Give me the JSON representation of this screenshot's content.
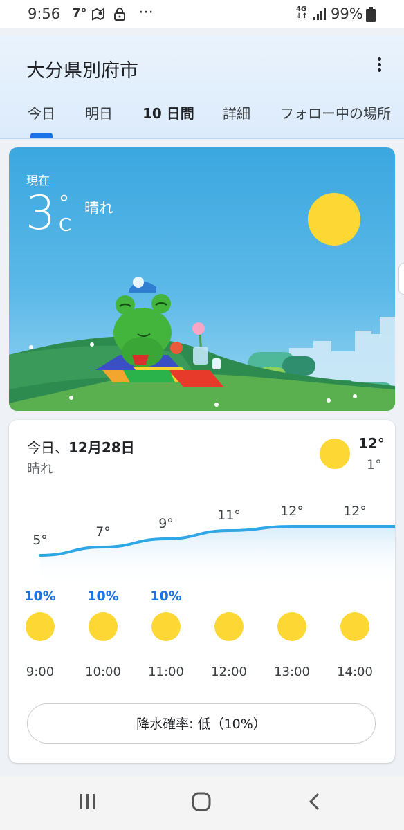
{
  "status_bar": {
    "time": "9:56",
    "temp": "7°",
    "network": "4G",
    "battery": "99%",
    "overflow": "⋯"
  },
  "header": {
    "city": "大分県別府市",
    "tabs": [
      {
        "label": "今日"
      },
      {
        "label": "明日"
      },
      {
        "label": "10 日間"
      },
      {
        "label": "詳細"
      },
      {
        "label": "フォロー中の場所"
      }
    ],
    "active_tab": 0
  },
  "current": {
    "label": "現在",
    "temp": "3",
    "deg": "°",
    "unit": "C",
    "condition": "晴れ"
  },
  "today": {
    "title_prefix": "今日、",
    "date": "12月28日",
    "condition": "晴れ",
    "high": "12°",
    "low": "1°",
    "rain_button": "降水確率: 低（10%）"
  },
  "chart_data": {
    "type": "line",
    "x": [
      "9:00",
      "10:00",
      "11:00",
      "12:00",
      "13:00",
      "14:00"
    ],
    "series": [
      {
        "values": [
          5,
          7,
          9,
          11,
          12,
          12
        ]
      }
    ],
    "point_labels": [
      "5°",
      "7°",
      "9°",
      "11°",
      "12°",
      "12°"
    ],
    "precipitation": [
      "10%",
      "10%",
      "10%",
      "",
      "",
      ""
    ],
    "ylim": [
      4,
      13
    ]
  },
  "colors": {
    "accent": "#1a73e8",
    "line": "#2fa6e6",
    "sun": "#fdd835",
    "sky": "#3ba7df"
  },
  "icons": {
    "more": "more-vert-icon",
    "nav_recent": "recent-apps-icon",
    "nav_home": "home-icon",
    "nav_back": "back-icon"
  }
}
